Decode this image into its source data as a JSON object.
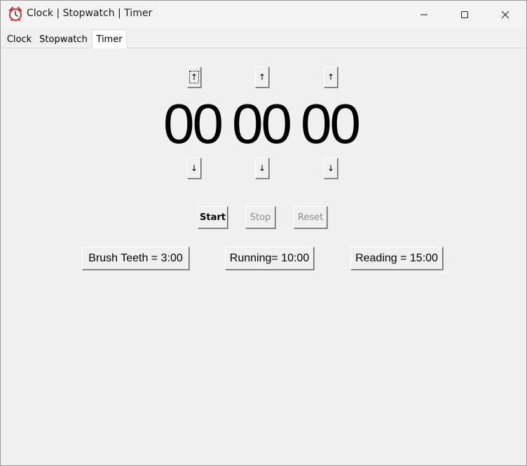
{
  "window": {
    "title": "Clock | Stopwatch | Timer",
    "icon": "alarm-clock-icon",
    "controls": [
      "minimize-icon",
      "maximize-icon",
      "close-icon"
    ]
  },
  "tabs": [
    {
      "label": "Clock",
      "active": false
    },
    {
      "label": "Stopwatch",
      "active": false
    },
    {
      "label": "Timer",
      "active": true
    }
  ],
  "timer": {
    "hours": "00",
    "minutes": "00",
    "seconds": "00",
    "up_arrow": "↑",
    "down_arrow": "↓"
  },
  "controls": {
    "start_label": "Start",
    "stop_label": "Stop",
    "reset_label": "Reset",
    "stop_enabled": false,
    "reset_enabled": false
  },
  "presets": [
    {
      "label": "Brush Teeth = 3:00"
    },
    {
      "label": "Running= 10:00"
    },
    {
      "label": "Reading = 15:00"
    }
  ],
  "colors": {
    "window_bg": "#f0f0f0",
    "disabled_text": "#8c8c8c",
    "icon_red": "#d13438"
  }
}
